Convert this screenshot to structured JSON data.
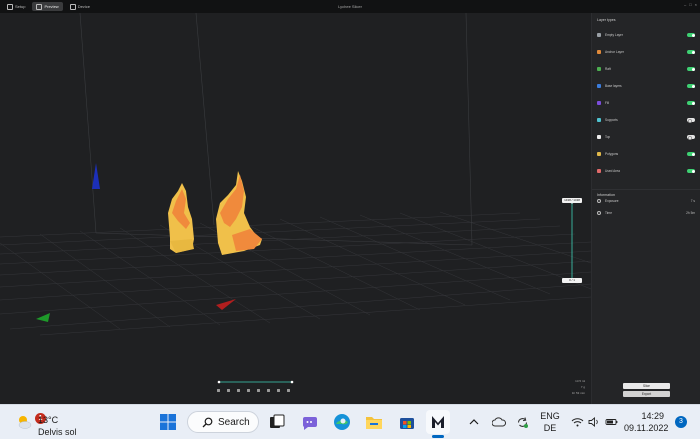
{
  "window": {
    "title": "Lychee Slicer",
    "tabs": [
      {
        "label": "Setup",
        "active": false
      },
      {
        "label": "Preview",
        "active": true
      },
      {
        "label": "Device",
        "active": false
      }
    ]
  },
  "panel": {
    "title": "Layer types",
    "layers": [
      {
        "label": "Empty Layer",
        "color": "#9aa0a6",
        "on": true
      },
      {
        "label": "Anchor Layer",
        "color": "#e08a3a",
        "on": true
      },
      {
        "label": "Raft",
        "color": "#4caf50",
        "on": true
      },
      {
        "label": "Base layers",
        "color": "#3b7ddd",
        "on": true
      },
      {
        "label": "Fill",
        "color": "#7c4ddb",
        "on": true
      },
      {
        "label": "Supports",
        "color": "#4fc3d0",
        "on": false
      },
      {
        "label": "Top",
        "color": "#eeeeee",
        "on": false
      },
      {
        "label": "Polygons",
        "color": "#e0b84a",
        "on": true
      },
      {
        "label": "Used Area",
        "color": "#e06a6a",
        "on": true
      }
    ],
    "info_title": "Information",
    "info": [
      {
        "label": "Exposure",
        "value": "7 s"
      },
      {
        "label": "Time",
        "value": "2h 5m"
      }
    ],
    "buttons": {
      "slice": "Slice",
      "export": "Export"
    }
  },
  "viewport": {
    "slider_top_label": "1438 / 1438",
    "slider_bottom_label": "0 / 1",
    "stats": [
      "13.5 ml",
      "7 g",
      "1h 53 min"
    ]
  },
  "taskbar": {
    "weather": {
      "temp": "13°C",
      "desc": "Delvis sol",
      "badge": "1"
    },
    "search_label": "Search",
    "lang": {
      "line1": "ENG",
      "line2": "DE"
    },
    "clock": {
      "time": "14:29",
      "date": "09.11.2022"
    },
    "notification_count": "3"
  }
}
